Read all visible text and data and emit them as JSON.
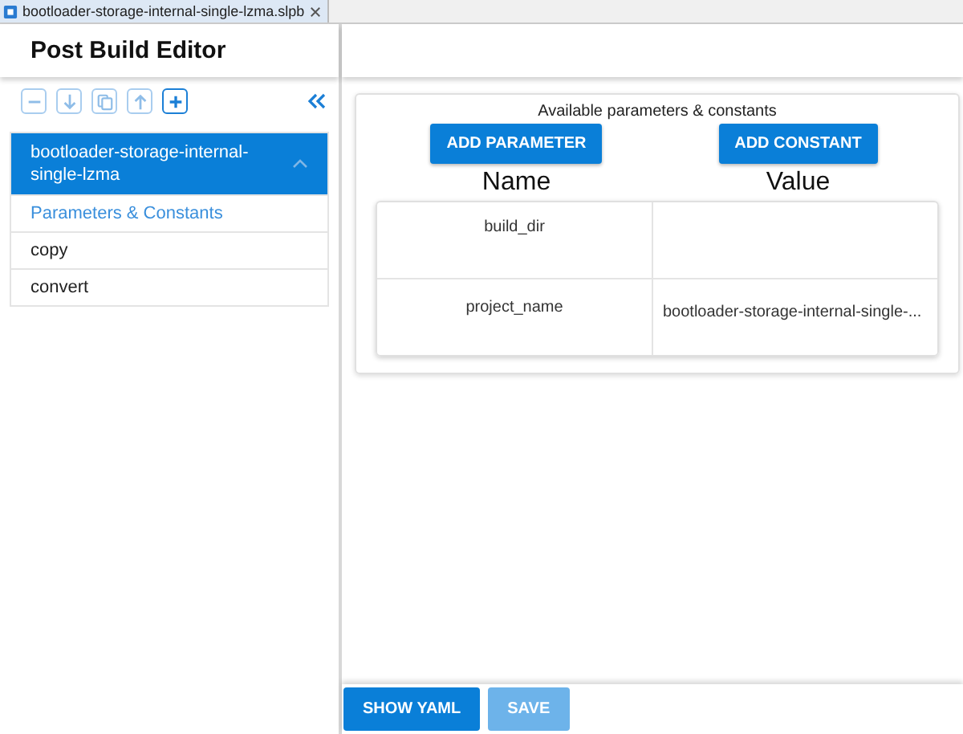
{
  "editor_tab": {
    "label": "bootloader-storage-internal-single-lzma.slpb"
  },
  "title": "Post Build Editor",
  "toolbar": [
    {
      "kind": "remove",
      "disabled": true
    },
    {
      "kind": "down",
      "disabled": true
    },
    {
      "kind": "copy",
      "disabled": true
    },
    {
      "kind": "up",
      "disabled": true
    },
    {
      "kind": "add",
      "disabled": false
    }
  ],
  "tree": [
    {
      "label": "bootloader-storage-internal-single-lzma",
      "selected": true,
      "expanded": true,
      "children": [
        {
          "label": "Parameters & Constants",
          "selected": true
        },
        {
          "label": "copy",
          "selected": false
        },
        {
          "label": "convert",
          "selected": false
        }
      ]
    }
  ],
  "panel": {
    "caption": "Available parameters & constants",
    "buttons": [
      "ADD PARAMETER",
      "ADD CONSTANT"
    ],
    "columns": [
      "Name",
      "Value"
    ],
    "rows": [
      [
        "build_dir",
        ""
      ],
      [
        "project_name",
        "bootloader-storage-internal-single-..."
      ]
    ]
  },
  "footer": [
    {
      "label": "SHOW YAML",
      "disabled": false
    },
    {
      "label": "SAVE",
      "disabled": true
    }
  ]
}
